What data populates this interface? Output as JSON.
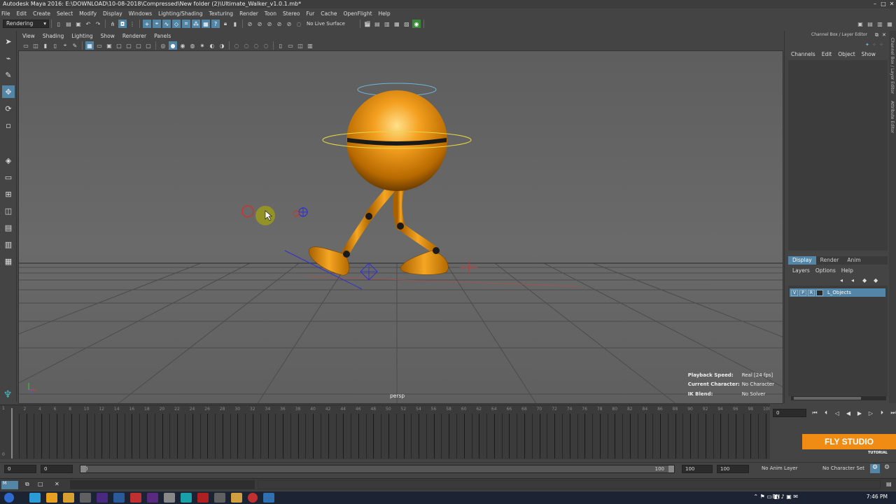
{
  "window": {
    "title": "Autodesk Maya 2016: E:\\DOWNLOAD\\10-08-2018\\Compressed\\New folder (2)\\Ultimate_Walker_v1.0.1.mb*"
  },
  "menubar": [
    "File",
    "Edit",
    "Create",
    "Select",
    "Modify",
    "Display",
    "Windows",
    "Lighting/Shading",
    "Texturing",
    "Render",
    "Toon",
    "Stereo",
    "Fur",
    "Cache",
    "OpenFlight",
    "Help"
  ],
  "statusline": {
    "menuset": "Rendering",
    "live_surface": "No Live Surface"
  },
  "panel_menu": [
    "View",
    "Shading",
    "Lighting",
    "Show",
    "Renderer",
    "Panels"
  ],
  "viewport": {
    "camera": "persp",
    "hud": [
      {
        "label": "Playback Speed:",
        "value": "Real [24 fps]"
      },
      {
        "label": "Current Character:",
        "value": "No Character"
      },
      {
        "label": "IK Blend:",
        "value": "No Solver"
      }
    ]
  },
  "right_panel": {
    "title": "Channel Box / Layer Editor",
    "tabs": [
      "Channels",
      "Edit",
      "Object",
      "Show"
    ],
    "vertical_tabs": [
      "Channel Box / Layer Editor",
      "Attribute Editor"
    ],
    "layer_tabs": [
      "Display",
      "Render",
      "Anim"
    ],
    "layer_menu": [
      "Layers",
      "Options",
      "Help"
    ],
    "layer": {
      "v": "V",
      "p": "P",
      "r": "R",
      "name": "L_Objects"
    }
  },
  "timeline": {
    "labels": [
      "2",
      "4",
      "6",
      "8",
      "10",
      "12",
      "14",
      "16",
      "18",
      "20",
      "22",
      "24",
      "26",
      "28",
      "30",
      "32",
      "34",
      "36",
      "38",
      "40",
      "42",
      "44",
      "46",
      "48",
      "50",
      "52",
      "54",
      "56",
      "58",
      "60",
      "62",
      "64",
      "66",
      "68",
      "70",
      "72",
      "74",
      "76",
      "78",
      "80",
      "82",
      "84",
      "86",
      "88",
      "90",
      "92",
      "94",
      "96",
      "98",
      "100"
    ],
    "current_frame": "0",
    "left_markers": [
      "1",
      "0"
    ]
  },
  "range": {
    "start": "0",
    "start2": "0",
    "slider_start": "0",
    "slider_end": "100",
    "end": "100",
    "end2": "100",
    "anim_layer": "No Anim Layer",
    "char_set": "No Character Set"
  },
  "watermark": {
    "title": "FLY STUDIO",
    "sub": "TUTORIAL"
  },
  "taskbar": {
    "lang": "EN",
    "time": "7:46 PM"
  },
  "colors": {
    "accent": "#5285a6",
    "character": "#f08c14",
    "logo": "#f08c14"
  }
}
